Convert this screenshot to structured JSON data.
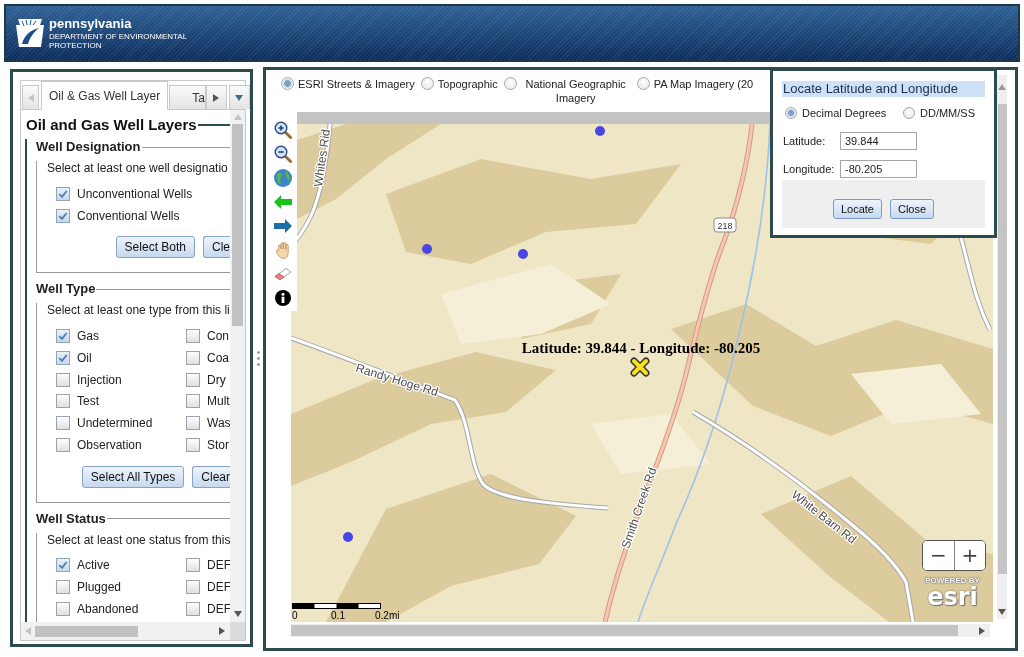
{
  "header": {
    "title": "pennsylvania",
    "subtitle": "DEPARTMENT OF ENVIRONMENTAL PROTECTION"
  },
  "layer_panel": {
    "tabs": [
      {
        "label": "Oil & Gas Well Layer",
        "selected": true
      },
      {
        "label": "Ta",
        "selected": false
      }
    ],
    "title": "Oil and Gas Well Layers",
    "groups": [
      {
        "legend": "Well Designation",
        "instruction": "Select at least one well designatio",
        "columns": [
          [
            {
              "label": "Unconventional Wells",
              "checked": true
            },
            {
              "label": "Conventional Wells",
              "checked": true
            }
          ]
        ],
        "buttons": [
          "Select Both",
          "Cle"
        ]
      },
      {
        "legend": "Well Type",
        "instruction": "Select at least one type from this li",
        "columns": [
          [
            {
              "label": "Gas",
              "checked": true
            },
            {
              "label": "Oil",
              "checked": true
            },
            {
              "label": "Injection",
              "checked": false
            },
            {
              "label": "Test",
              "checked": false
            },
            {
              "label": "Undetermined",
              "checked": false
            },
            {
              "label": "Observation",
              "checked": false
            }
          ],
          [
            {
              "label": "Con",
              "checked": false
            },
            {
              "label": "Coa",
              "checked": false
            },
            {
              "label": "Dry",
              "checked": false
            },
            {
              "label": "Mult",
              "checked": false
            },
            {
              "label": "Was",
              "checked": false
            },
            {
              "label": "Stor",
              "checked": false
            }
          ]
        ],
        "buttons": [
          "Select All Types",
          "Clear"
        ]
      },
      {
        "legend": "Well Status",
        "instruction": "Select at least one status from this",
        "columns": [
          [
            {
              "label": "Active",
              "checked": true
            },
            {
              "label": "Plugged",
              "checked": false
            },
            {
              "label": "Abandoned",
              "checked": false
            }
          ],
          [
            {
              "label": "DEF",
              "checked": false
            },
            {
              "label": "DEF",
              "checked": false
            },
            {
              "label": "DEF",
              "checked": false
            }
          ]
        ]
      }
    ]
  },
  "map": {
    "basemaps": [
      {
        "label": "ESRI Streets & Imagery",
        "selected": true
      },
      {
        "label": "Topographic",
        "selected": false
      },
      {
        "label": "National Geographic Imagery",
        "selected": false
      },
      {
        "label": "PA Map Imagery (20",
        "selected": false
      }
    ],
    "road_labels": [
      "Whites Rid",
      "Randy Hoge Rd",
      "Smith Creek Rd",
      "White Barn Rd"
    ],
    "route_shield": "218",
    "location_label": "Latitude: 39.844 - Longitude: -80.205",
    "scale_labels": [
      "0",
      "0.1",
      "0.2mi"
    ],
    "zoom_buttons": [
      "−",
      "+"
    ],
    "attribution": {
      "caption": "POWERED BY",
      "logo": "esri"
    }
  },
  "locate_dialog": {
    "title": "Locate Latitude and Longitude",
    "formats": [
      {
        "label": "Decimal Degrees",
        "selected": true
      },
      {
        "label": "DD/MM/SS",
        "selected": false
      }
    ],
    "fields": [
      {
        "label": "Latitude:",
        "value": "39.844"
      },
      {
        "label": "Longitude:",
        "value": "-80.205"
      }
    ],
    "buttons": [
      "Locate",
      "Close"
    ]
  }
}
